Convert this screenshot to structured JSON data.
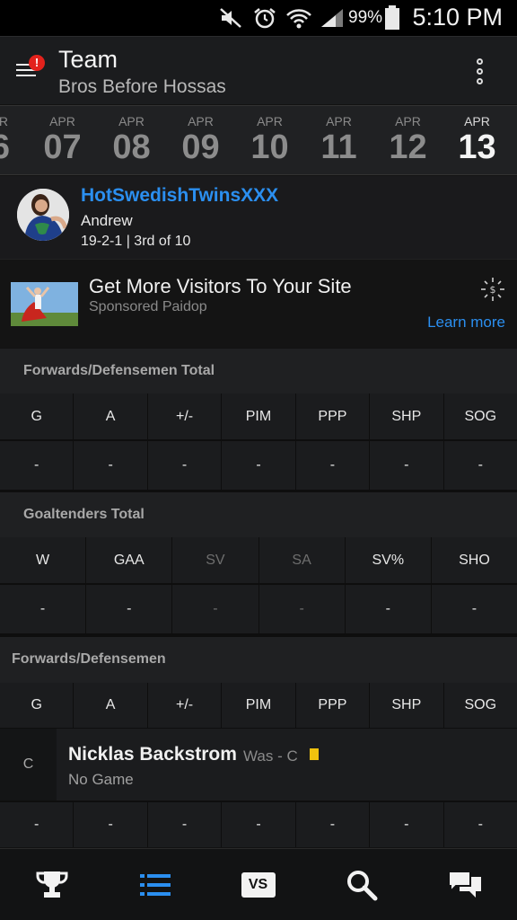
{
  "status_bar": {
    "battery_percent": "99%",
    "time": "5:10 PM",
    "icons": [
      "mute-icon",
      "alarm-icon",
      "wifi-icon",
      "signal-icon",
      "battery-icon"
    ]
  },
  "header": {
    "title": "Team",
    "subtitle": "Bros Before Hossas",
    "notification_badge": "!"
  },
  "date_strip": {
    "partial_left_day": "6",
    "partial_left_month": "R",
    "dates": [
      {
        "month": "APR",
        "day": "07"
      },
      {
        "month": "APR",
        "day": "08"
      },
      {
        "month": "APR",
        "day": "09"
      },
      {
        "month": "APR",
        "day": "10"
      },
      {
        "month": "APR",
        "day": "11"
      },
      {
        "month": "APR",
        "day": "12"
      },
      {
        "month": "APR",
        "day": "13",
        "selected": true
      }
    ]
  },
  "team_card": {
    "team_name": "HotSwedishTwinsXXX",
    "owner": "Andrew",
    "record": "19-2-1 | 3rd of 10"
  },
  "ad": {
    "title": "Get More Visitors To Your Site",
    "sponsor": "Sponsored Paidop",
    "cta": "Learn more"
  },
  "fd_total": {
    "heading": "Forwards/Defensemen Total",
    "columns": [
      "G",
      "A",
      "+/-",
      "PIM",
      "PPP",
      "SHP",
      "SOG"
    ],
    "values": [
      "-",
      "-",
      "-",
      "-",
      "-",
      "-",
      "-"
    ]
  },
  "goalie_total": {
    "heading": "Goaltenders Total",
    "columns": [
      "W",
      "GAA",
      "SV",
      "SA",
      "SV%",
      "SHO"
    ],
    "values": [
      "-",
      "-",
      "-",
      "-",
      "-",
      "-"
    ],
    "dimmed": [
      false,
      false,
      true,
      true,
      false,
      false
    ]
  },
  "fd_players": {
    "heading": "Forwards/Defensemen",
    "columns": [
      "G",
      "A",
      "+/-",
      "PIM",
      "PPP",
      "SHP",
      "SOG"
    ],
    "players": [
      {
        "position": "C",
        "name": "Nicklas Backstrom",
        "was": "Was - C",
        "game": "No Game",
        "stats": [
          "-",
          "-",
          "-",
          "-",
          "-",
          "-",
          "-"
        ]
      }
    ]
  },
  "bottom_nav": {
    "items": [
      {
        "name": "trophy-icon",
        "active": false
      },
      {
        "name": "list-icon",
        "active": true
      },
      {
        "name": "vs-icon",
        "label": "VS",
        "active": false
      },
      {
        "name": "search-icon",
        "active": false
      },
      {
        "name": "chat-icon",
        "active": false
      }
    ]
  },
  "colors": {
    "accent": "#2b8ff0",
    "badge": "#e3221c",
    "note": "#f0c20e"
  }
}
